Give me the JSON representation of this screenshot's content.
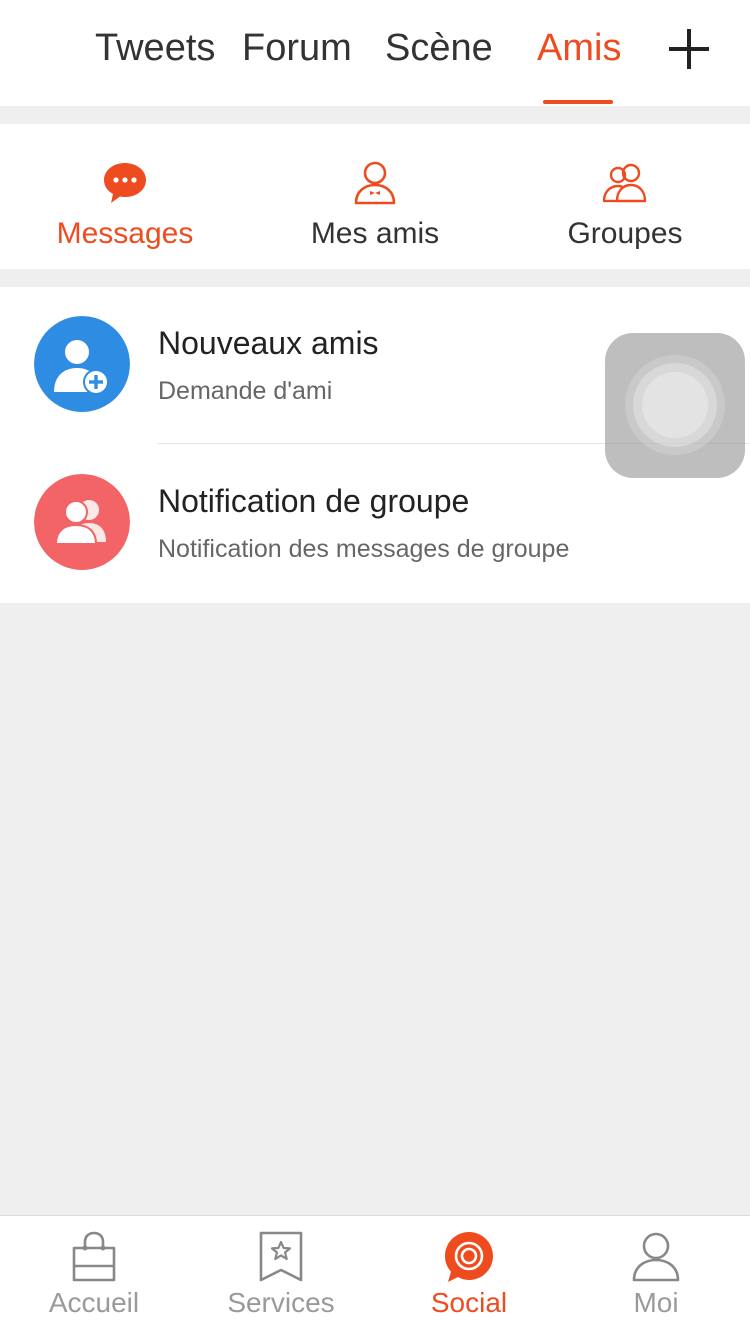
{
  "colors": {
    "accent": "#ee4c1f",
    "blue_avatar": "#2e8de2",
    "red_avatar": "#f26465"
  },
  "top_nav": {
    "tabs": [
      "Tweets",
      "Forum",
      "Scène",
      "Amis"
    ],
    "active_tab": "Amis",
    "add_icon": "plus-icon"
  },
  "segments": {
    "items": [
      {
        "label": "Messages",
        "icon": "chat-bubble-icon"
      },
      {
        "label": "Mes amis",
        "icon": "person-icon"
      },
      {
        "label": "Groupes",
        "icon": "group-icon"
      }
    ],
    "active": "Messages"
  },
  "list": [
    {
      "title": "Nouveaux amis",
      "subtitle": "Demande d'ami",
      "icon": "add-friend-icon"
    },
    {
      "title": "Notification de groupe",
      "subtitle": "Notification des messages de groupe",
      "icon": "group-notification-icon"
    }
  ],
  "bottom_tabs": {
    "items": [
      {
        "label": "Accueil",
        "icon": "bag-icon"
      },
      {
        "label": "Services",
        "icon": "bookmark-star-icon"
      },
      {
        "label": "Social",
        "icon": "social-target-icon"
      },
      {
        "label": "Moi",
        "icon": "user-icon"
      }
    ],
    "active": "Social"
  }
}
